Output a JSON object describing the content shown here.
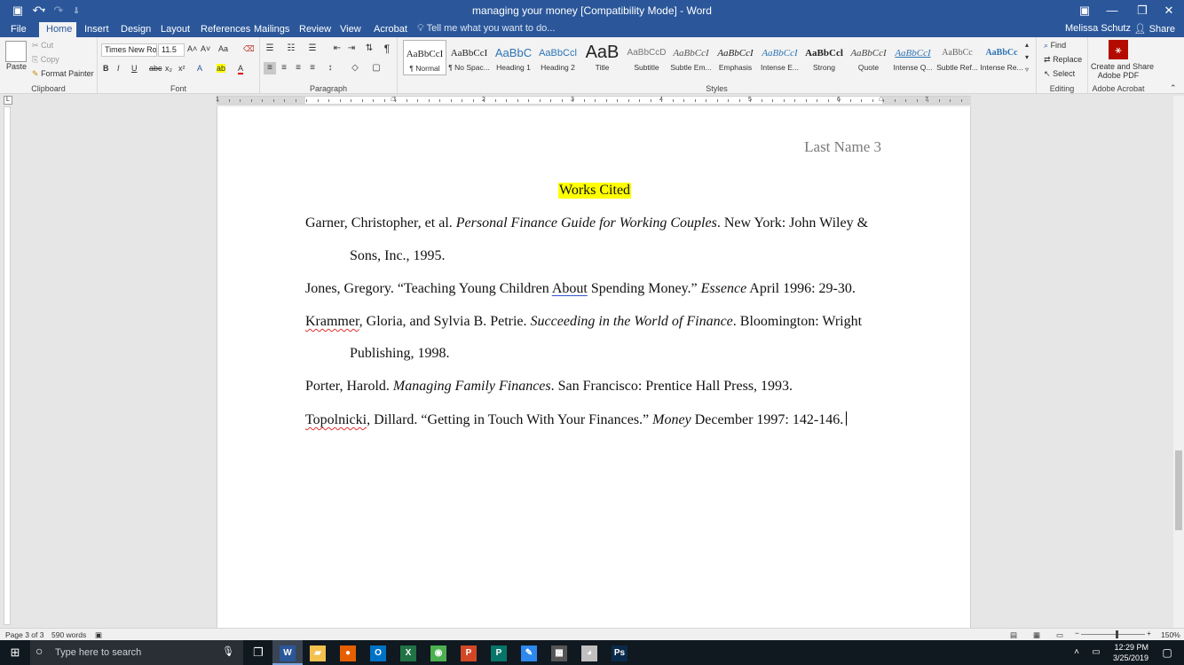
{
  "window": {
    "title": "managing your money [Compatibility Mode] - Word",
    "controls": {
      "ribbon_opts": "▣",
      "minimize": "—",
      "maximize": "❐",
      "close": "✕"
    },
    "quick_access": {
      "save": "▣",
      "undo": "↶",
      "undo_drop": "▾",
      "redo": "↷",
      "customize": "⇩"
    }
  },
  "tabs": [
    "File",
    "Home",
    "Insert",
    "Design",
    "Layout",
    "References",
    "Mailings",
    "Review",
    "View",
    "Acrobat"
  ],
  "tellme": "Tell me what you want to do...",
  "user": "Melissa Schutz",
  "share": "Share",
  "ribbon": {
    "clipboard": {
      "paste": "Paste",
      "cut": "Cut",
      "copy": "Copy",
      "format_painter": "Format Painter",
      "label": "Clipboard"
    },
    "font": {
      "name": "Times New Ro",
      "size": "11.5",
      "label": "Font",
      "grow": "A˄",
      "shrink": "A˅",
      "case": "Aa",
      "clear": "⌫",
      "bold": "B",
      "italic": "I",
      "underline": "U",
      "strike": "abc",
      "sub": "x₂",
      "sup": "x²",
      "effects": "A",
      "highlight": "ab",
      "color": "A"
    },
    "paragraph": {
      "label": "Paragraph",
      "pilcrow": "¶",
      "bullets": "☰",
      "numbering": "☷",
      "multilevel": "☰",
      "dec_indent": "⇤",
      "inc_indent": "⇥",
      "sort": "⇅",
      "align_left": "≡",
      "align_center": "≡",
      "align_right": "≡",
      "justify": "≡",
      "spacing": "↕",
      "shading": "◇",
      "borders": "▢"
    },
    "styles": {
      "label": "Styles",
      "items": [
        {
          "sample": "AaBbCcI",
          "name": "¶ Normal"
        },
        {
          "sample": "AaBbCcI",
          "name": "¶ No Spac..."
        },
        {
          "sample": "AaBbC",
          "name": "Heading 1"
        },
        {
          "sample": "AaBbCcl",
          "name": "Heading 2"
        },
        {
          "sample": "AaB",
          "name": "Title"
        },
        {
          "sample": "AaBbCcD",
          "name": "Subtitle"
        },
        {
          "sample": "AaBbCcI",
          "name": "Subtle Em..."
        },
        {
          "sample": "AaBbCcI",
          "name": "Emphasis"
        },
        {
          "sample": "AaBbCcI",
          "name": "Intense E..."
        },
        {
          "sample": "AaBbCcl",
          "name": "Strong"
        },
        {
          "sample": "AaBbCcI",
          "name": "Quote"
        },
        {
          "sample": "AaBbCcI",
          "name": "Intense Q..."
        },
        {
          "sample": "AaBbCc",
          "name": "Subtle Ref..."
        },
        {
          "sample": "AaBbCc",
          "name": "Intense Re..."
        }
      ],
      "scroll_up": "▴",
      "scroll_down": "▾",
      "more": "▿"
    },
    "editing": {
      "find": "Find",
      "replace": "Replace",
      "select": "Select",
      "label": "Editing"
    },
    "acrobat": {
      "create": "Create and Share",
      "create2": "Adobe PDF",
      "label": "Adobe Acrobat"
    }
  },
  "ruler": [
    "1",
    "1",
    "2",
    "3",
    "4",
    "5",
    "6",
    "7"
  ],
  "ruler_corner": "L",
  "document": {
    "header": "Last Name 3",
    "title": "Works Cited",
    "citations": {
      "c1a": "Garner, Christopher, et al. ",
      "c1i": "Personal Finance Guide for Working Couples",
      "c1b": ". New York: John Wiley &",
      "c1c": "Sons, Inc., 1995.",
      "c2a": "Jones, Gregory. “Teaching Young Children ",
      "c2s": "About",
      "c2b": " Spending Money.” ",
      "c2i": "Essence",
      "c2c": " April 1996: 29-30.",
      "c3s": "Krammer",
      "c3a": ", Gloria, and Sylvia B. Petrie. ",
      "c3i": "Succeeding in the World of Finance",
      "c3b": ". Bloomington: Wright",
      "c3c": "Publishing, 1998.",
      "c4a": "Porter, Harold. ",
      "c4i": "Managing Family Finances",
      "c4b": ". San Francisco: Prentice Hall Press, 1993.",
      "c5s": "Topolnicki",
      "c5a": ", Dillard. “Getting in Touch With Your Finances.” ",
      "c5i": "Money",
      "c5b": " December 1997: 142-146."
    }
  },
  "statusbar": {
    "page": "Page 3 of 3",
    "words": "590 words",
    "zoom": "150%",
    "zoom_minus": "−",
    "zoom_plus": "+"
  },
  "taskbar": {
    "search_placeholder": "Type here to search",
    "time": "12:29 PM",
    "date": "3/25/2019",
    "apps": [
      {
        "name": "word",
        "glyph": "W",
        "color": "#2b579a"
      },
      {
        "name": "explorer",
        "glyph": "▰",
        "color": "#f2c14e"
      },
      {
        "name": "firefox",
        "glyph": "●",
        "color": "#e66000"
      },
      {
        "name": "outlook",
        "glyph": "O",
        "color": "#0072c6"
      },
      {
        "name": "excel",
        "glyph": "X",
        "color": "#217346"
      },
      {
        "name": "chrome",
        "glyph": "◉",
        "color": "#4caf50"
      },
      {
        "name": "powerpoint",
        "glyph": "P",
        "color": "#d24726"
      },
      {
        "name": "publisher",
        "glyph": "P",
        "color": "#077568"
      },
      {
        "name": "sticky",
        "glyph": "✎",
        "color": "#2d89ef"
      },
      {
        "name": "calculator",
        "glyph": "▦",
        "color": "#555555"
      },
      {
        "name": "paint",
        "glyph": "◕",
        "color": "#c0c0c0"
      },
      {
        "name": "photoshop",
        "glyph": "Ps",
        "color": "#0b2a4a"
      }
    ]
  }
}
